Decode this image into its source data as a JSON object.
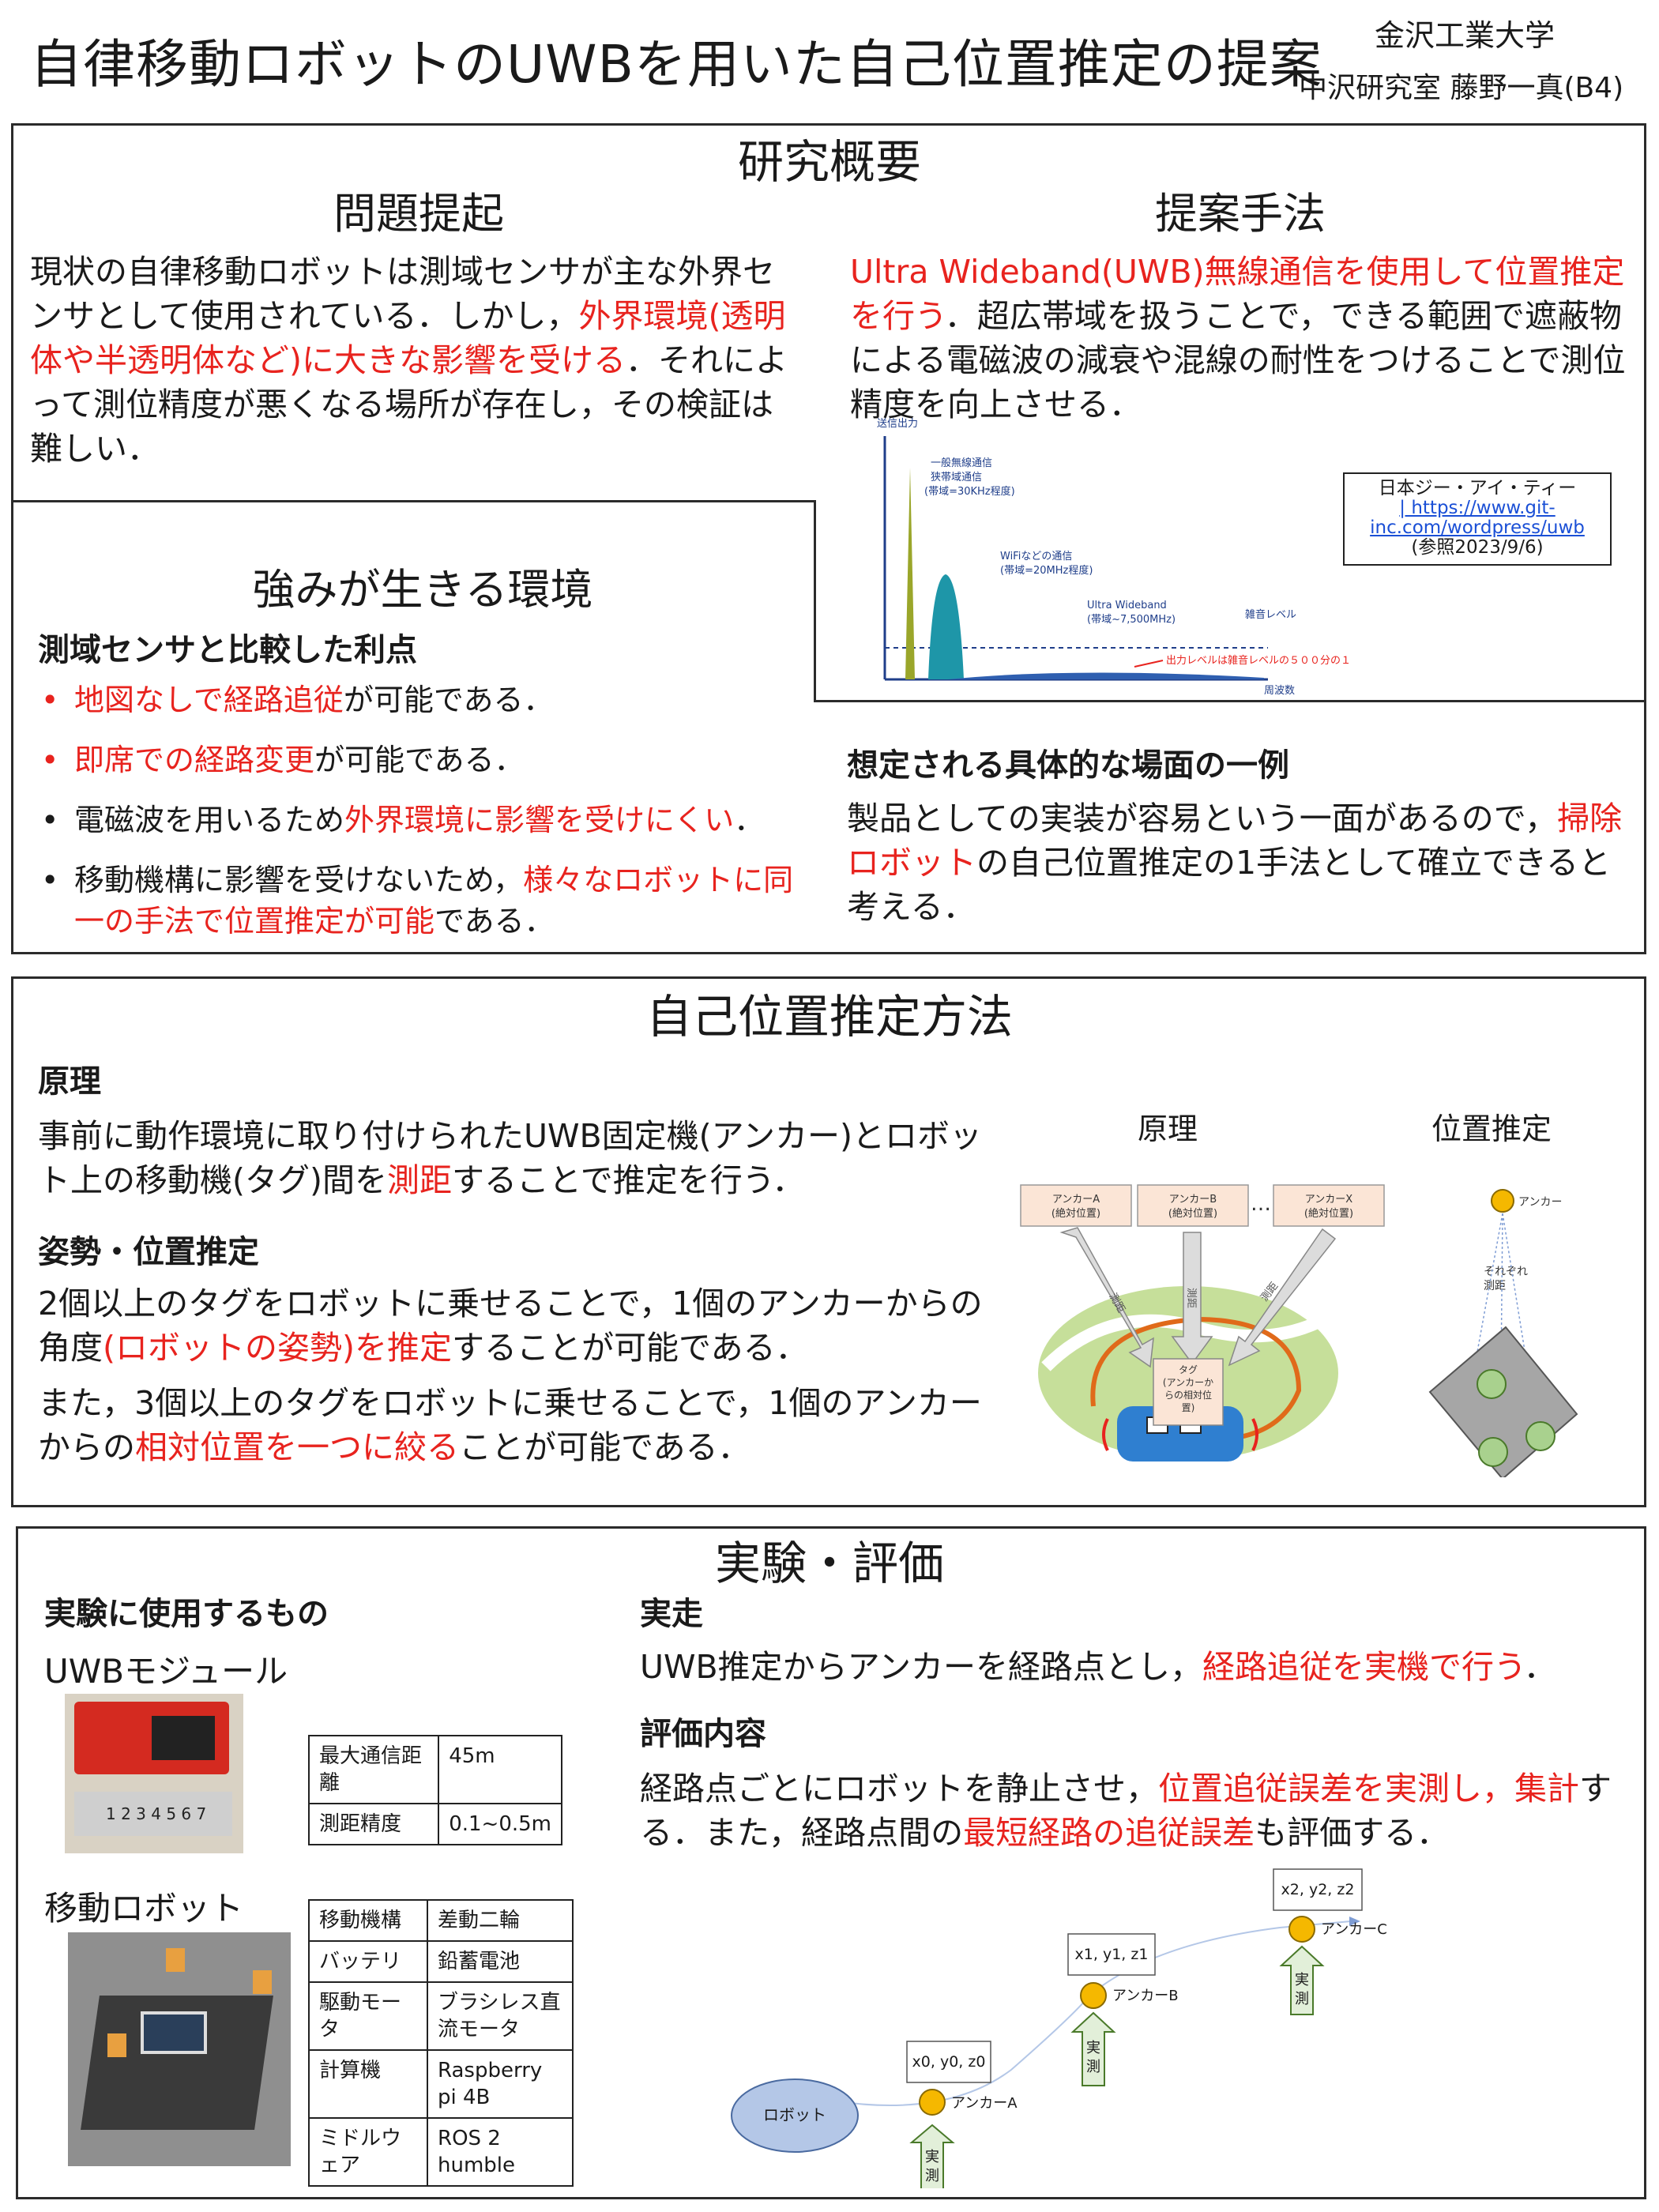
{
  "header": {
    "title": "自律移動ロボットのUWBを用いた自己位置推定の提案",
    "affiliation": "金沢工業大学",
    "author": "中沢研究室 藤野一真(B4)"
  },
  "overview": {
    "title": "研究概要",
    "problem": {
      "heading": "問題提起",
      "p1": "現状の自律移動ロボットは測域センサが主な外界センサとして使用されている．しかし，",
      "p1_red": "外界環境(透明体や半透明体など)に大きな影響を受ける",
      "p1_end": "．それによって測位精度が悪くなる場所が存在し，その検証は難しい．"
    },
    "method": {
      "heading": "提案手法",
      "p_red": "Ultra Wideband(UWB)無線通信を使用して位置推定を行う",
      "p_end": "．超広帯域を扱うことで，できる範囲で遮蔽物による電磁波の減衰や混線の耐性をつけることで測位精度を向上させる．",
      "chart_ylabel": "送信出力",
      "chart_xlabel": "周波数",
      "label_general1": "一般無線通信",
      "label_general2": "狭帯域通信",
      "label_general3": "(帯域=30KHz程度)",
      "label_wifi1": "WiFiなどの通信",
      "label_wifi2": "(帯域=20MHz程度)",
      "label_uwb1": "Ultra Wideband",
      "label_uwb2": "(帯域~7,500MHz)",
      "label_noise": "雑音レベル",
      "label_output": "出力レベルは雑音レベルの５００分の１",
      "credit1": "日本ジー・アイ・ティー",
      "credit2": "| https://www.git-",
      "credit3": "inc.com/wordpress/uwb",
      "credit4": "(参照2023/9/6)"
    },
    "strength": {
      "heading": "強みが生きる環境",
      "subheading": "測域センサと比較した利点",
      "b1_red": "地図なしで経路追従",
      "b1_end": "が可能である．",
      "b2_red": "即席での経路変更",
      "b2_end": "が可能である．",
      "b3_start": "電磁波を用いるため",
      "b3_red": "外界環境に影響を受けにくい",
      "b3_end": "．",
      "b4_start": "移動機構に影響を受けないため，",
      "b4_red": "様々なロボットに同一の手法で位置推定が可能",
      "b4_end": "である．",
      "bullet": "•"
    },
    "scene": {
      "heading": "想定される具体的な場面の一例",
      "p_start": "製品としての実装が容易という一面があるので，",
      "p_red": "掃除ロボット",
      "p_end": "の自己位置推定の1手法として確立できると考える．"
    }
  },
  "estimation": {
    "title": "自己位置推定方法",
    "principle_heading": "原理",
    "principle_start": "事前に動作環境に取り付けられたUWB固定機(アンカー)とロボット上の移動機(タグ)間を",
    "principle_red": "測距",
    "principle_end": "することで推定を行う．",
    "pose_heading": "姿勢・位置推定",
    "pose_p1_start": "2個以上のタグをロボットに乗せることで，1個のアンカーからの角度",
    "pose_p1_red": "(ロボットの姿勢)を推定",
    "pose_p1_end": "することが可能である．",
    "pose_p2_start": "また，3個以上のタグをロボットに乗せることで，1個のアンカーからの",
    "pose_p2_red": "相対位置を一つに絞る",
    "pose_p2_end": "ことが可能である．",
    "fig_principle": "原理",
    "fig_position": "位置推定",
    "anchor_a1": "アンカーA",
    "anchor_a2": "(絶対位置)",
    "anchor_b1": "アンカーB",
    "anchor_b2": "(絶対位置)",
    "anchor_x1": "アンカーX",
    "anchor_x2": "(絶対位置)",
    "dots": "…",
    "measure": "測距",
    "tag1": "タグ",
    "tag2": "(アンカーか",
    "tag3": "らの相対位",
    "tag4": "置)",
    "anchor_label": "アンカー",
    "each_distance1": "それぞれ",
    "each_distance2": "測距"
  },
  "experiment": {
    "title": "実験・評価",
    "used_heading": "実験に使用するもの",
    "uwb_module": "UWBモジュール",
    "ruler": "1 2 3 4 5 6 7",
    "uwb_table": [
      [
        "最大通信距離",
        "45m"
      ],
      [
        "測距精度",
        "0.1~0.5m"
      ]
    ],
    "robot_heading": "移動ロボット",
    "robot_table": [
      [
        "移動機構",
        "差動二輪"
      ],
      [
        "バッテリ",
        "鉛蓄電池"
      ],
      [
        "駆動モータ",
        "ブラシレス直流モータ"
      ],
      [
        "計算機",
        "Raspberry pi 4B"
      ],
      [
        "ミドルウェア",
        "ROS 2 humble"
      ]
    ],
    "run_heading": "実走",
    "run_start": "UWB推定からアンカーを経路点とし，",
    "run_red": "経路追従を実機で行う",
    "run_end": "．",
    "eval_heading": "評価内容",
    "eval_start": "経路点ごとにロボットを静止させ，",
    "eval_red1": "位置追従誤差を実測し，集計",
    "eval_mid": "する．また，経路点間の",
    "eval_red2": "最短経路の追従誤差",
    "eval_end": "も評価する．",
    "robot_node": "ロボット",
    "anchor_a": "アンカーA",
    "anchor_b": "アンカーB",
    "anchor_c": "アンカーC",
    "coord_a": "x0, y0, z0",
    "coord_b": "x1, y1, z1",
    "coord_c": "x2, y2, z2",
    "measured1": "実",
    "measured2": "測"
  },
  "colors": {
    "accent_red": "#e8231e",
    "anchor_yellow": "#f5b800",
    "robot_blue": "#b4c7e7",
    "green_arrow": "#e2efd9",
    "dark_blue": "#1f3e8a"
  }
}
